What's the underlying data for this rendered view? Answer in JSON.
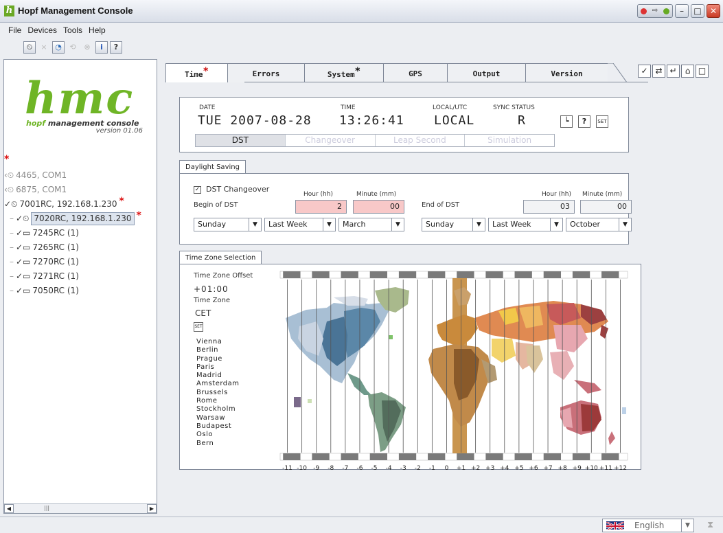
{
  "window": {
    "title": "Hopf Management Console"
  },
  "menu": {
    "file": "File",
    "devices": "Devices",
    "tools": "Tools",
    "help": "Help"
  },
  "logo": {
    "text": "hmc",
    "sub_brand": "hopf",
    "sub_text": "management console",
    "version": "version 01.06"
  },
  "tree": {
    "items": [
      {
        "label": "4465, COM1"
      },
      {
        "label": "6875, COM1"
      },
      {
        "label": "7001RC, 192.168.1.230"
      },
      {
        "label": "7020RC, 192.168.1.230"
      },
      {
        "label": "7245RC (1)"
      },
      {
        "label": "7265RC (1)"
      },
      {
        "label": "7270RC (1)"
      },
      {
        "label": "7271RC (1)"
      },
      {
        "label": "7050RC (1)"
      }
    ]
  },
  "tabs": {
    "time": "Time",
    "errors": "Errors",
    "system": "System",
    "gps": "GPS",
    "output": "Output",
    "version": "Version"
  },
  "status": {
    "date_label": "DATE",
    "date_value": "TUE 2007-08-28",
    "time_label": "TIME",
    "time_value": "13:26:41",
    "localutc_label": "LOCAL/UTC",
    "localutc_value": "LOCAL",
    "sync_label": "SYNC STATUS",
    "sync_value": "R",
    "help_btn": "?",
    "set_btn": "SET",
    "segments": [
      "DST",
      "Changeover",
      "Leap Second",
      "Simulation"
    ]
  },
  "dst": {
    "group_title": "Daylight Saving",
    "checkbox_label": "DST Changeover",
    "begin_label": "Begin of DST",
    "end_label": "End of DST",
    "hour_label": "Hour (hh)",
    "minute_label": "Minute (mm)",
    "begin_hour": "2",
    "begin_minute": "00",
    "end_hour": "03",
    "end_minute": "00",
    "begin_day": "Sunday",
    "begin_week": "Last Week",
    "begin_month": "March",
    "end_day": "Sunday",
    "end_week": "Last Week",
    "end_month": "October"
  },
  "timezone": {
    "group_title": "Time Zone Selection",
    "offset_label": "Time Zone Offset",
    "offset_value": "+01:00",
    "zone_label": "Time Zone",
    "zone_value": "CET",
    "set_btn": "SET",
    "cities": [
      "Vienna",
      "Berlin",
      "Prague",
      "Paris",
      "Madrid",
      "Amsterdam",
      "Brussels",
      "Rome",
      "Stockholm",
      "Warsaw",
      "Budapest",
      "Oslo",
      "Bern"
    ],
    "axis": [
      "-11",
      "-10",
      "-9",
      "-8",
      "-7",
      "-6",
      "-5",
      "-4",
      "-3",
      "-2",
      "-1",
      "0",
      "+1",
      "+2",
      "+3",
      "+4",
      "+5",
      "+6",
      "+7",
      "+8",
      "+9",
      "+10",
      "+11",
      "+12"
    ],
    "selected_zone": "+1"
  },
  "statusbar": {
    "language": "English"
  },
  "colors": {
    "logo_green": "#6fb526",
    "error_red": "#d11111",
    "pink_field": "#f8c8c8",
    "selected_band": "#c9954f"
  }
}
